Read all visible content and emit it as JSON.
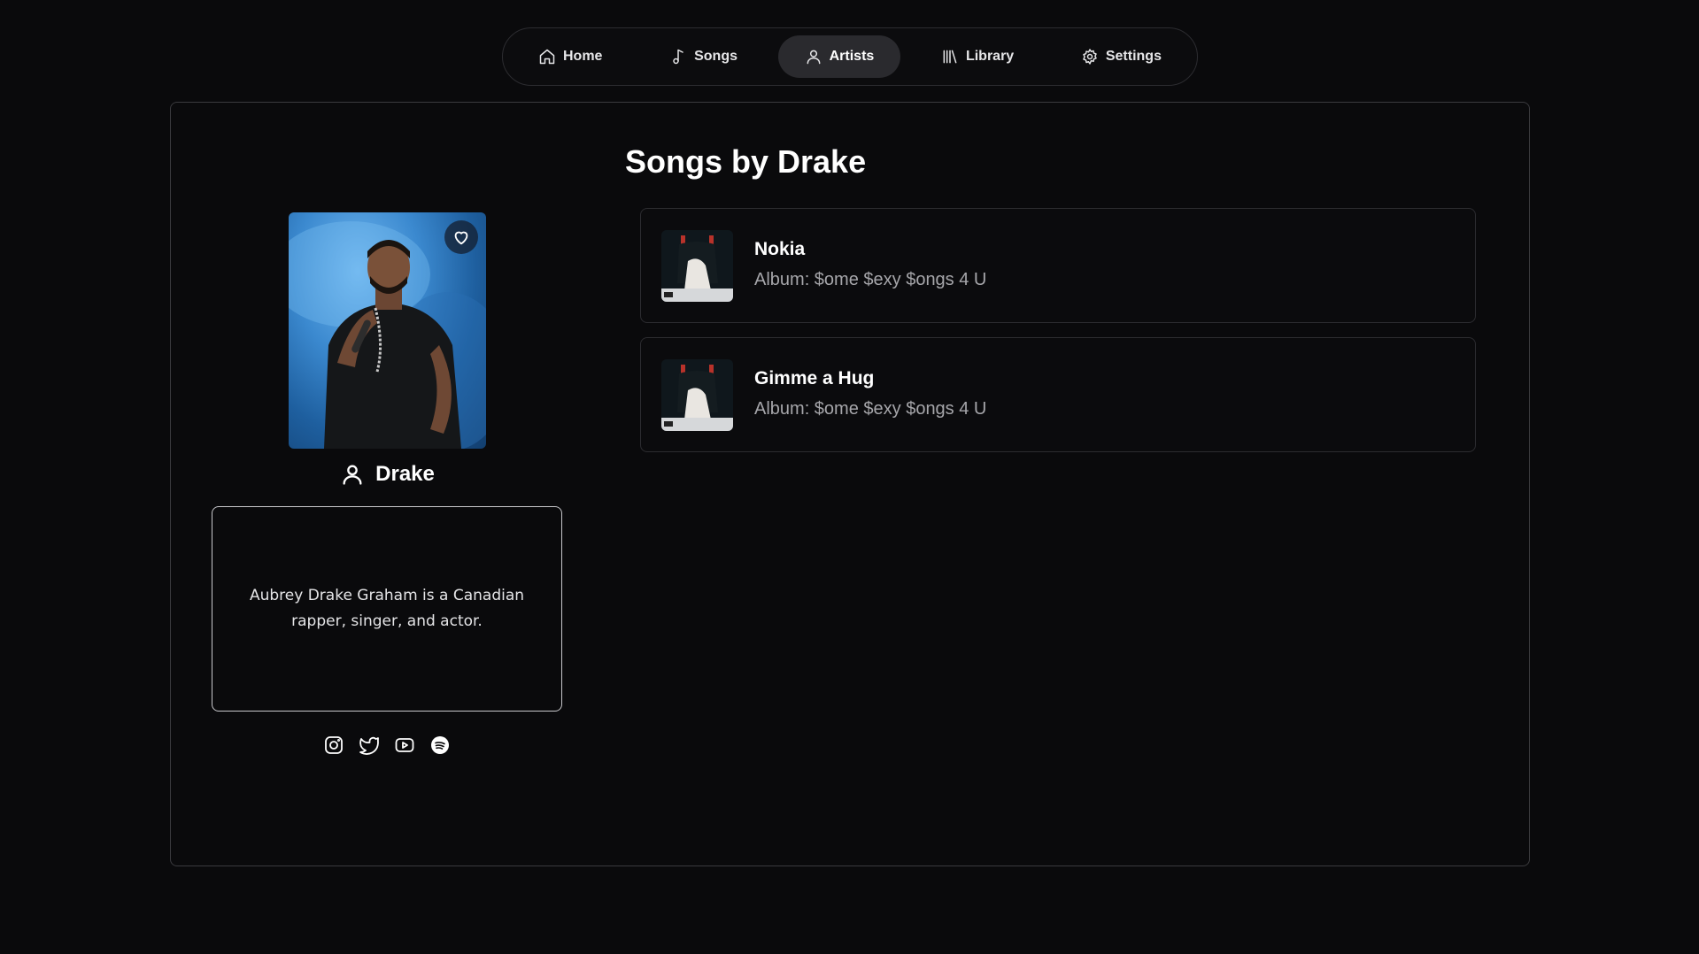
{
  "nav": {
    "items": [
      {
        "label": "Home",
        "icon": "home-icon"
      },
      {
        "label": "Songs",
        "icon": "music-note-icon"
      },
      {
        "label": "Artists",
        "icon": "user-icon",
        "active": true
      },
      {
        "label": "Library",
        "icon": "library-icon"
      },
      {
        "label": "Settings",
        "icon": "gear-icon"
      }
    ]
  },
  "artist": {
    "name": "Drake",
    "bio": "Aubrey Drake Graham is a Canadian rapper, singer, and actor.",
    "socials": [
      "instagram-icon",
      "twitter-icon",
      "youtube-icon",
      "spotify-icon"
    ]
  },
  "songs": {
    "heading": "Songs by Drake",
    "items": [
      {
        "title": "Nokia",
        "album": "Album: $ome $exy $ongs 4 U"
      },
      {
        "title": "Gimme a Hug",
        "album": "Album: $ome $exy $ongs 4 U"
      }
    ]
  },
  "colors": {
    "background": "#0a0a0c",
    "active_nav": "#2a2a2e",
    "muted_text": "#a6a6aa"
  }
}
